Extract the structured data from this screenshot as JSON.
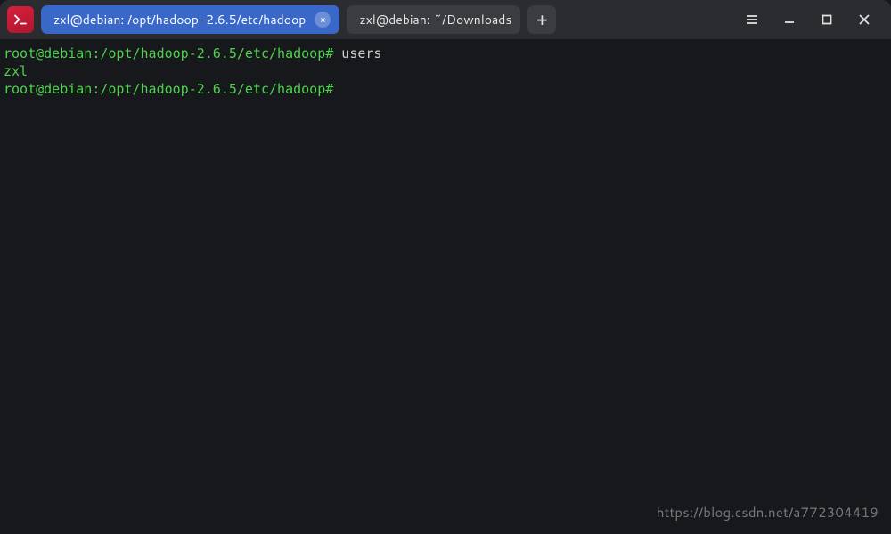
{
  "tabs": [
    {
      "label": "zxl@debian: /opt/hadoop-2.6.5/etc/hadoop",
      "active": true
    },
    {
      "label": "zxl@debian: ~/Downloads",
      "active": false
    }
  ],
  "terminal": {
    "lines": [
      {
        "prompt": "root@debian:/opt/hadoop-2.6.5/etc/hadoop#",
        "cmd": " users"
      },
      {
        "prompt": "zxl",
        "cmd": ""
      },
      {
        "prompt": "root@debian:/opt/hadoop-2.6.5/etc/hadoop#",
        "cmd": " "
      }
    ]
  },
  "watermark": "https://blog.csdn.net/a772304419",
  "icons": {
    "close_glyph": "×",
    "plus_glyph": "+"
  }
}
